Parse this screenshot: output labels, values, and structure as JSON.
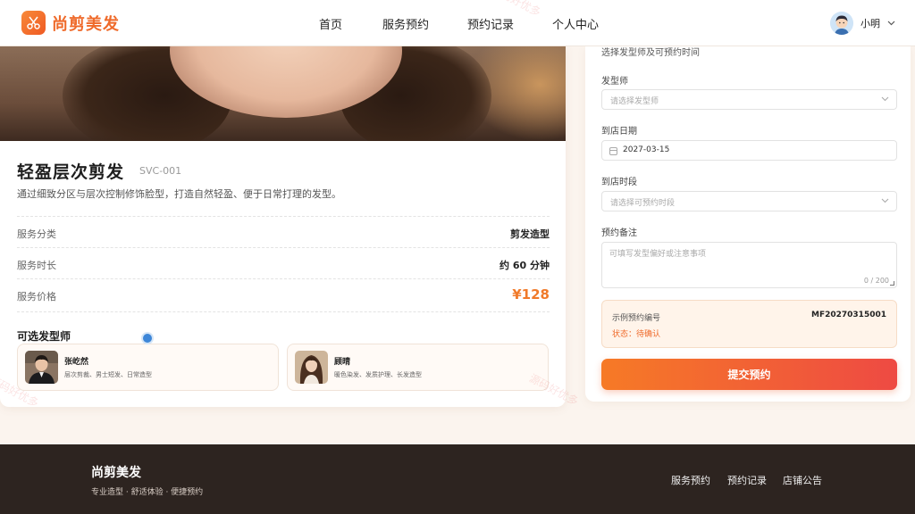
{
  "brand": {
    "name": "尚剪美发",
    "logo_icon": "scissors-icon",
    "accent": "#ef6a2a"
  },
  "nav": {
    "items": [
      {
        "label": "首页"
      },
      {
        "label": "服务预约"
      },
      {
        "label": "预约记录"
      },
      {
        "label": "个人中心"
      }
    ]
  },
  "user": {
    "name": "小明",
    "menu_icon": "chevron-down-icon"
  },
  "service": {
    "title": "轻盈层次剪发",
    "code": "SVC-001",
    "description": "通过细致分区与层次控制修饰脸型，打造自然轻盈、便于日常打理的发型。",
    "rows": [
      {
        "label": "服务分类",
        "value": "剪发造型"
      },
      {
        "label": "服务时长",
        "value": "约 60 分钟"
      },
      {
        "label": "服务价格",
        "value": "¥128"
      }
    ],
    "stylists_title": "可选发型师",
    "stylists": [
      {
        "name": "张屹然",
        "tags": "层次剪裁、男士短发、日常造型"
      },
      {
        "name": "顾晴",
        "tags": "暖色染发、发质护理、长发造型"
      }
    ]
  },
  "form": {
    "subtitle": "选择发型师及可预约时间",
    "stylist_label": "发型师",
    "stylist_placeholder": "请选择发型师",
    "date_label": "到店日期",
    "date_value": "2027-03-15",
    "slot_label": "到店时段",
    "slot_placeholder": "请选择可预约时段",
    "note_label": "预约备注",
    "note_placeholder": "可填写发型偏好或注意事项",
    "note_counter": "0 / 200",
    "example_label": "示例预约编号",
    "example_code": "MF20270315001",
    "example_status": "状态：待确认",
    "submit_label": "提交预约"
  },
  "footer": {
    "brand": "尚剪美发",
    "tagline": "专业造型 · 舒适体验 · 便捷预约",
    "links": [
      {
        "label": "服务预约"
      },
      {
        "label": "预约记录"
      },
      {
        "label": "店铺公告"
      }
    ]
  },
  "watermark": "源码好优多"
}
